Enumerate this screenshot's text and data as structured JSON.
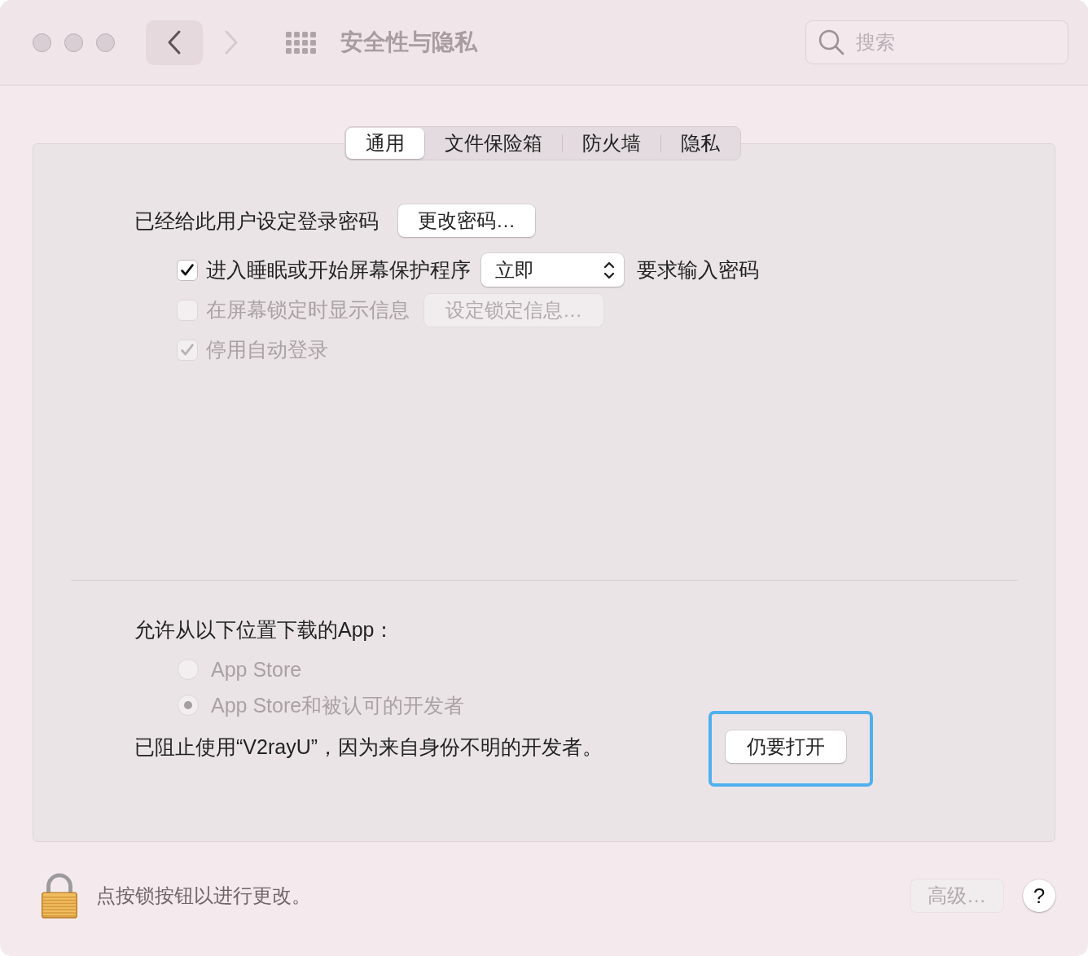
{
  "window": {
    "title": "安全性与隐私",
    "back_enabled": true,
    "forward_enabled": false,
    "search": {
      "placeholder": "搜索"
    }
  },
  "tabs": [
    {
      "label": "通用",
      "selected": true
    },
    {
      "label": "文件保险箱",
      "selected": false
    },
    {
      "label": "防火墙",
      "selected": false
    },
    {
      "label": "隐私",
      "selected": false
    }
  ],
  "password": {
    "label": "已经给此用户设定登录密码",
    "button": "更改密码…"
  },
  "options": [
    {
      "kind": "select",
      "label": "进入睡眠或开始屏幕保护程序",
      "checked": true,
      "disabled": false,
      "value": "立即",
      "suffix": "要求输入密码"
    },
    {
      "kind": "button",
      "label": "在屏幕锁定时显示信息",
      "checked": false,
      "disabled": true,
      "button": "设定锁定信息…"
    },
    {
      "kind": "plain",
      "label": "停用自动登录",
      "checked": true,
      "disabled": true
    }
  ],
  "downloads": {
    "label": "允许从以下位置下载的App：",
    "sources": [
      {
        "label": "App Store",
        "selected": false,
        "disabled": true
      },
      {
        "label": "App Store和被认可的开发者",
        "selected": true,
        "disabled": true
      }
    ],
    "blocked_message": "已阻止使用“V2rayU”，因为来自身份不明的开发者。",
    "open_button": {
      "label": "仍要打开",
      "highlighted": true
    }
  },
  "footer": {
    "lock_text": "点按锁按钮以进行更改。",
    "advanced_button": {
      "label": "高级…",
      "disabled": true
    },
    "help_button": "?"
  }
}
